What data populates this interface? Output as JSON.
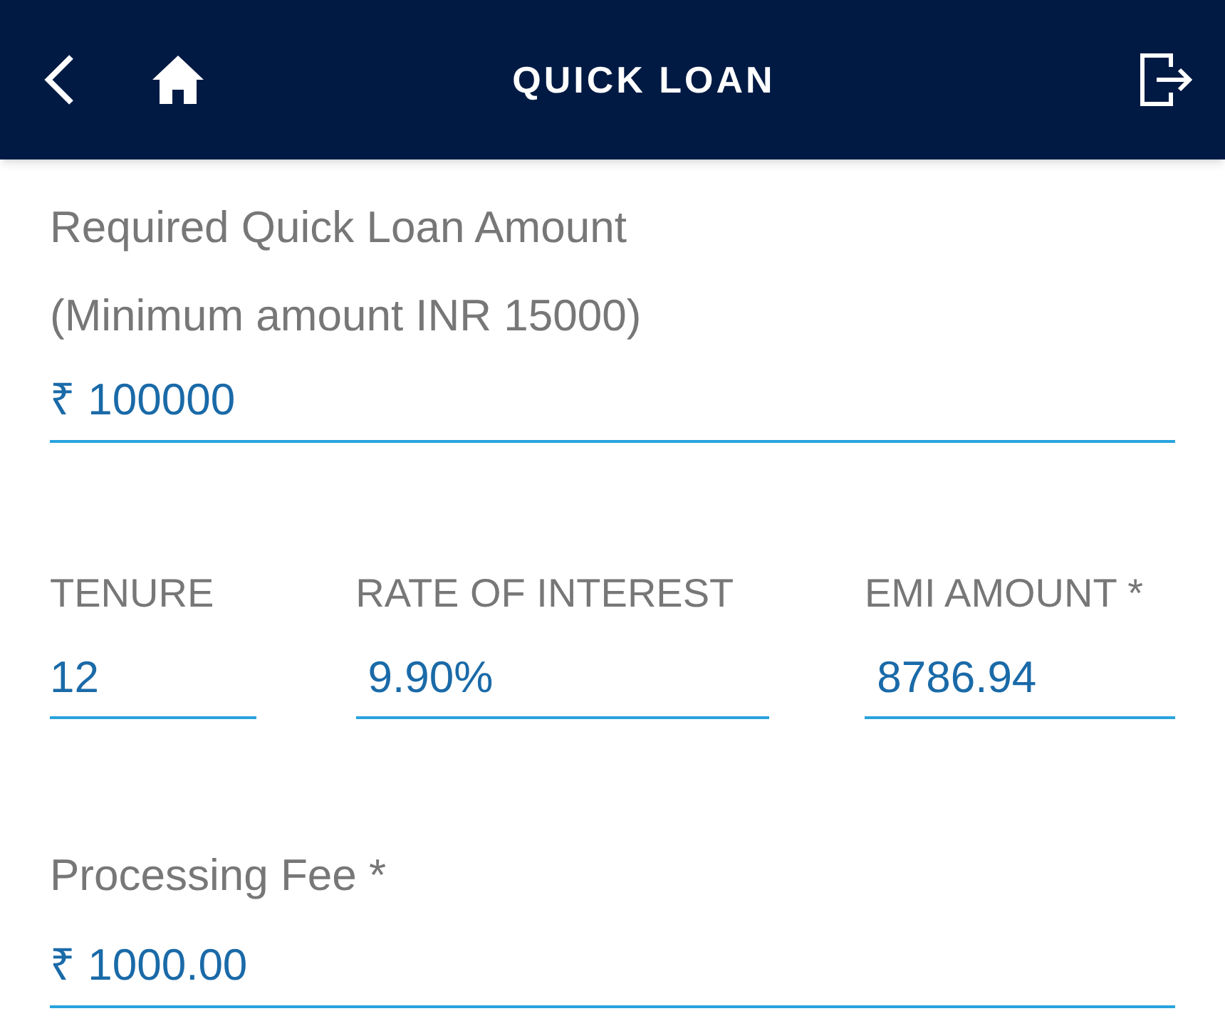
{
  "header": {
    "title": "QUICK LOAN"
  },
  "amount": {
    "label": "Required Quick Loan Amount",
    "hint": "(Minimum amount INR 15000)",
    "value": "₹ 100000"
  },
  "fields": [
    {
      "label": "TENURE",
      "value": "12"
    },
    {
      "label": "RATE OF INTEREST",
      "value": " 9.90%"
    },
    {
      "label": "EMI AMOUNT *",
      "value": " 8786.94"
    }
  ],
  "processing_fee": {
    "label": "Processing Fee *",
    "value": "₹ 1000.00"
  }
}
